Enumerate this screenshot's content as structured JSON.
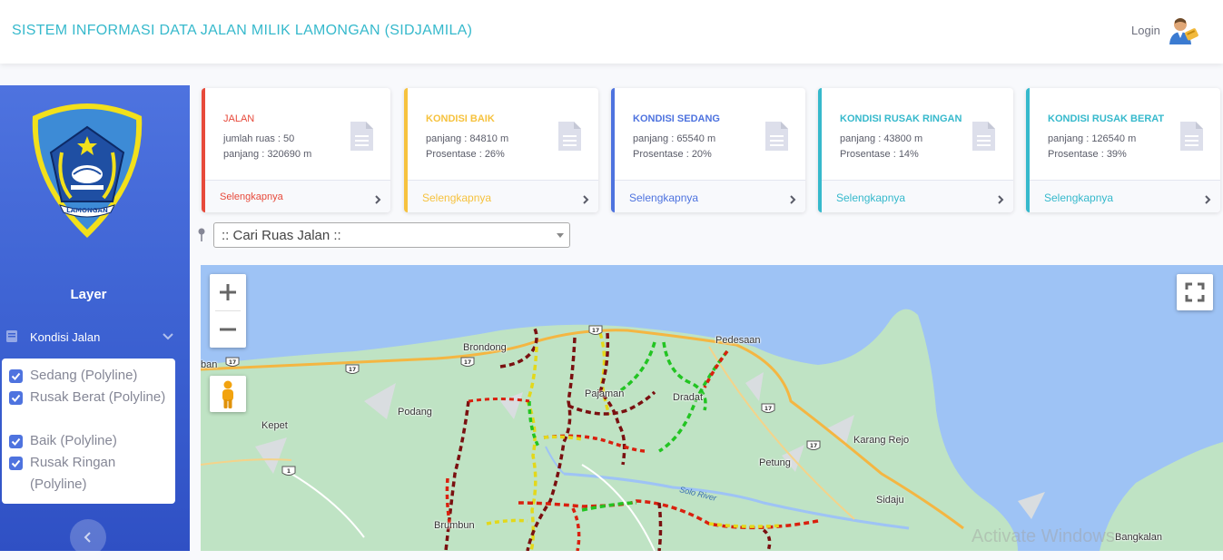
{
  "header": {
    "title": "SISTEM INFORMASI DATA JALAN MILIK LAMONGAN (SIDJAMILA)",
    "login_label": "Login"
  },
  "sidebar": {
    "logo_text": "LAMONGAN",
    "layer_title": "Layer",
    "menu_label": "Kondisi Jalan",
    "layers": [
      {
        "label": "Sedang (Polyline)",
        "checked": true
      },
      {
        "label": "Rusak Berat (Polyline)",
        "checked": true
      },
      {
        "label": "Baik (Polyline)",
        "checked": true
      },
      {
        "label": "Rusak Ringan (Polyline)",
        "checked": true
      }
    ]
  },
  "cards": [
    {
      "title": "JALAN",
      "line1": "jumlah ruas : 50",
      "line2": "panjang : 320690 m",
      "more": "Selengkapnya",
      "color": "#e74a3b"
    },
    {
      "title": "KONDISI BAIK",
      "line1": "panjang : 84810 m",
      "line2": "Prosentase : 26%",
      "more": "Selengkapnya",
      "color": "#f6c23e"
    },
    {
      "title": "KONDISI SEDANG",
      "line1": "panjang : 65540 m",
      "line2": "Prosentase : 20%",
      "more": "Selengkapnya",
      "color": "#4e73df"
    },
    {
      "title": "KONDISI RUSAK RINGAN",
      "line1": "panjang : 43800 m",
      "line2": "Prosentase : 14%",
      "more": "Selengkapnya",
      "color": "#36b9cc"
    },
    {
      "title": "KONDISI RUSAK BERAT",
      "line1": "panjang : 126540 m",
      "line2": "Prosentase : 39%",
      "more": "Selengkapnya",
      "color": "#36b9cc"
    }
  ],
  "search": {
    "placeholder": ":: Cari Ruas Jalan ::"
  },
  "map": {
    "places": {
      "brondong": "Brondong",
      "pedesaan": "Pedesaan",
      "ban": "ban",
      "pajaman": "Pajaman",
      "dradat": "Dradat",
      "podang": "Podang",
      "kepet": "Kepet",
      "karang_rejo": "Karang Rejo",
      "petung": "Petung",
      "sidaju": "Sidaju",
      "brumbun": "Brumbun",
      "bangkalan": "Bangkalan"
    },
    "river": "Solo River",
    "route_a": "17",
    "route_b": "1",
    "watermark": "Activate Windows"
  },
  "colors": {
    "primary": "#4e73df",
    "info": "#36b9cc",
    "warning": "#f6c23e",
    "danger": "#e74a3b",
    "road_good": "#22c422",
    "road_medium": "#e3d81a",
    "road_light_damage": "#d9200e",
    "road_heavy_damage": "#7a1010"
  }
}
